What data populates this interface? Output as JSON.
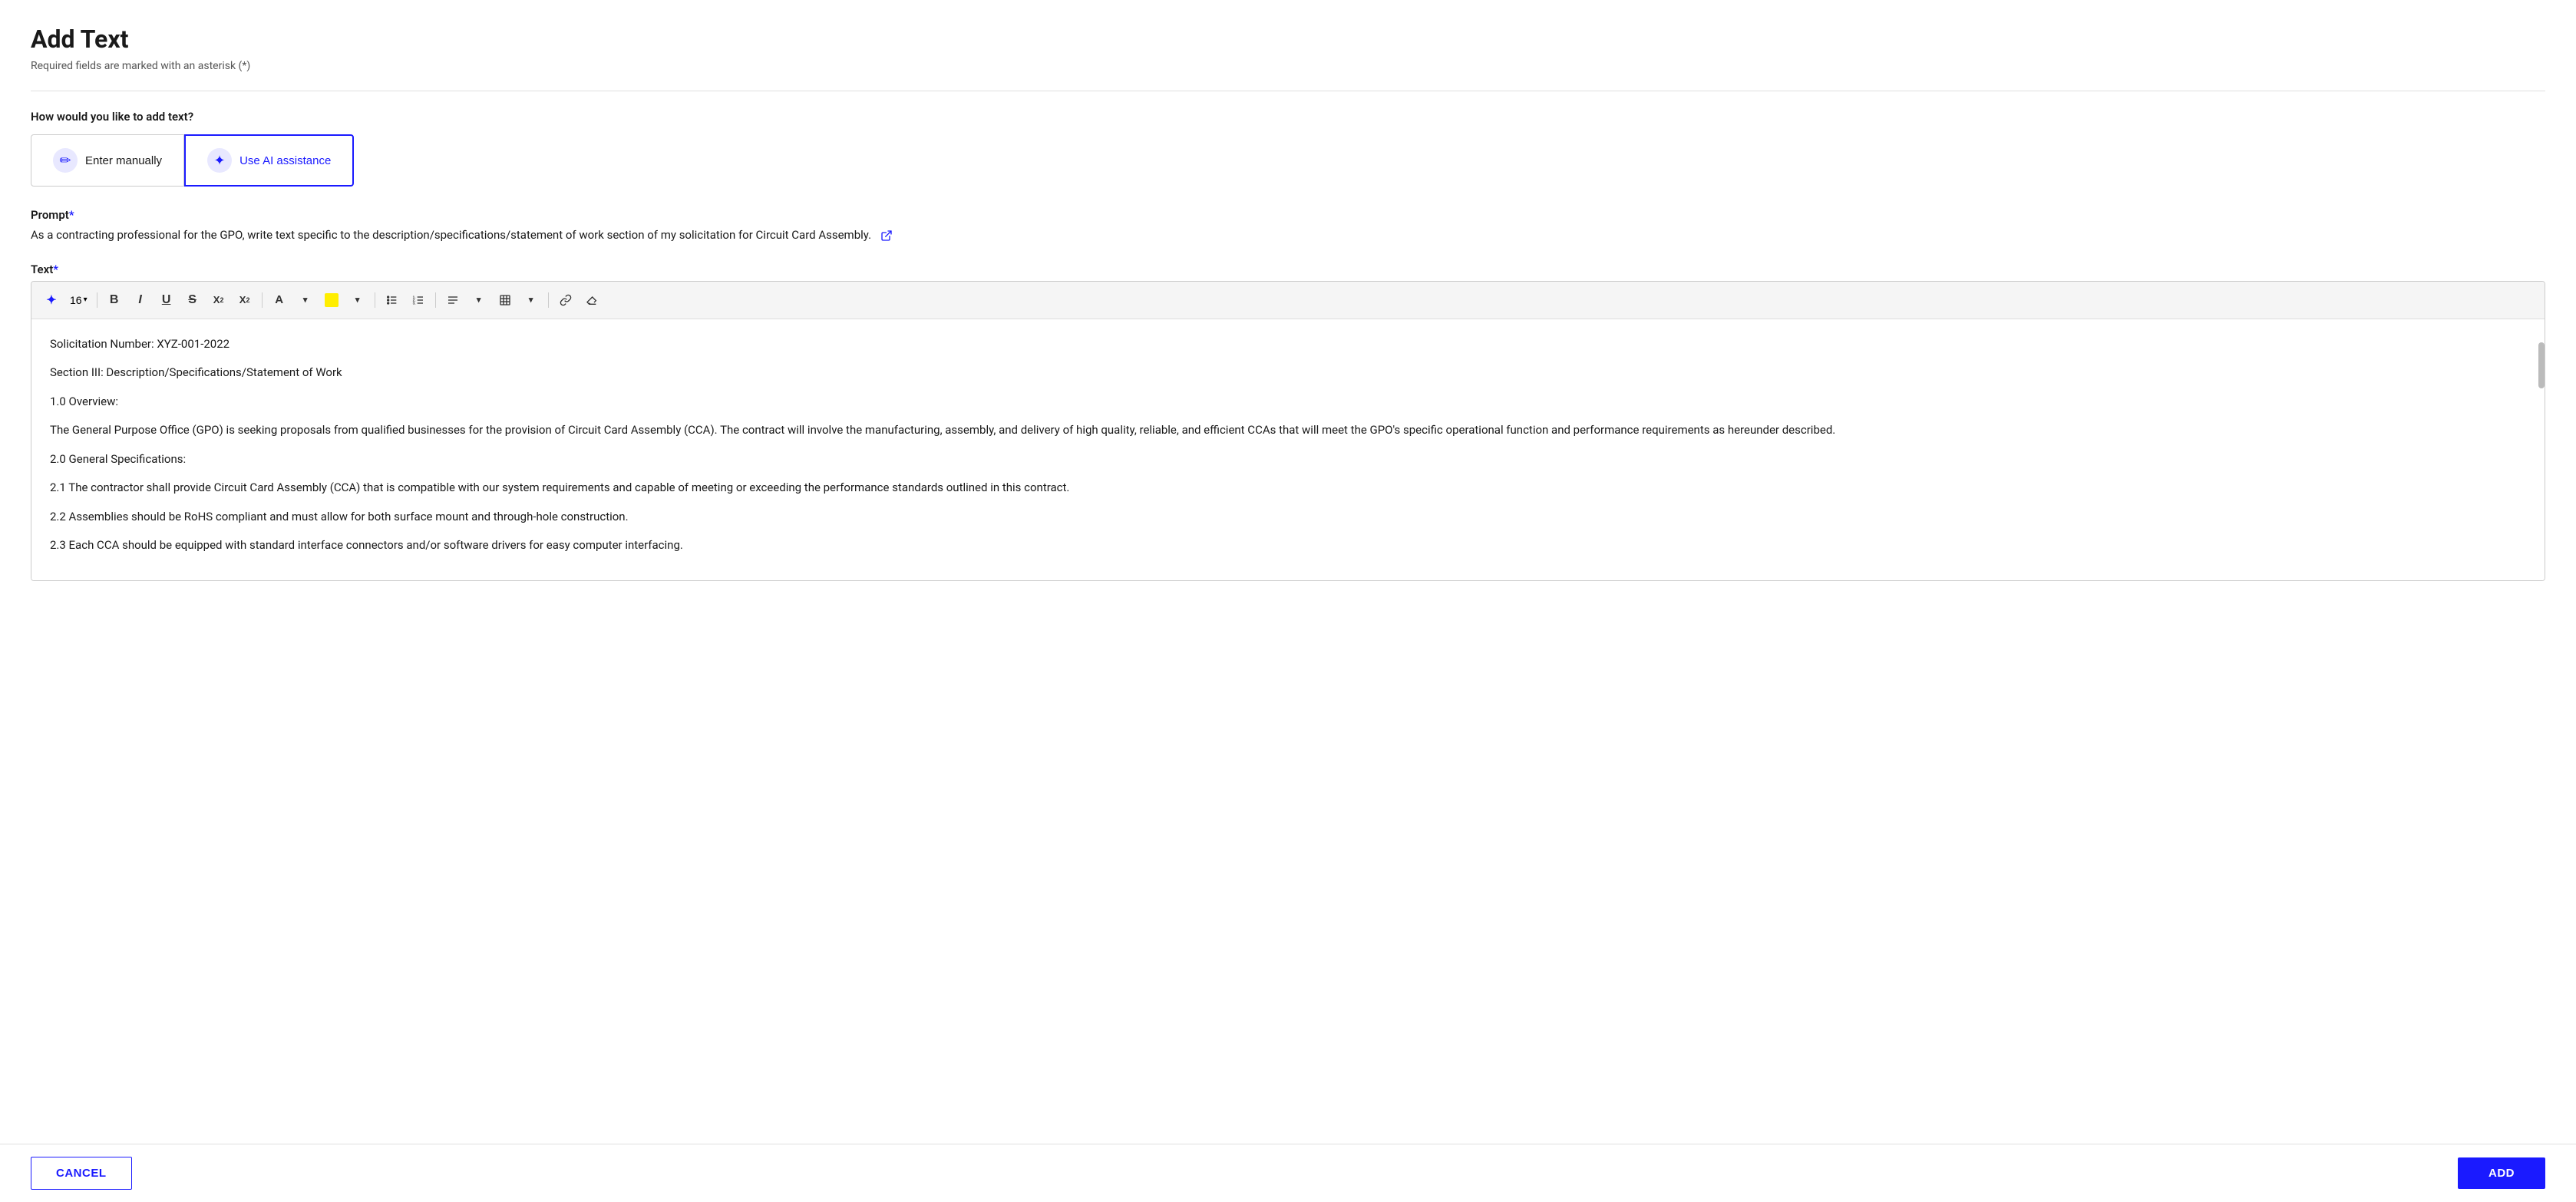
{
  "page": {
    "title": "Add Text",
    "required_note": "Required fields are marked with an asterisk (*)"
  },
  "input_method": {
    "question": "How would you like to add text?",
    "options": [
      {
        "id": "manual",
        "label": "Enter manually",
        "icon": "pencil-icon",
        "active": false
      },
      {
        "id": "ai",
        "label": "Use AI assistance",
        "icon": "ai-sparkle-icon",
        "active": true
      }
    ]
  },
  "prompt_field": {
    "label": "Prompt",
    "required": true,
    "value": "As a contracting professional for the GPO, write text specific to the description/specifications/statement of work section of my solicitation for Circuit Card Assembly.",
    "link_icon": "external-link-icon"
  },
  "text_field": {
    "label": "Text",
    "required": true,
    "toolbar": {
      "ai_btn": "✦",
      "font_size": "16",
      "bold": "B",
      "italic": "I",
      "underline": "U",
      "strikethrough": "S",
      "superscript": "X²",
      "subscript": "X₂",
      "font_color": "A",
      "highlight_color": "highlight",
      "unordered_list": "ul",
      "ordered_list": "ol",
      "align": "align",
      "table": "table",
      "link": "link",
      "eraser": "eraser"
    },
    "content": [
      "Solicitation Number: XYZ-001-2022",
      "Section III: Description/Specifications/Statement of Work",
      "1.0 Overview:",
      "The General Purpose Office (GPO) is seeking proposals from qualified businesses for the provision of Circuit Card Assembly (CCA). The contract will involve the manufacturing, assembly, and delivery of high quality, reliable, and efficient CCAs that will meet the GPO's specific operational function and performance requirements as hereunder described.",
      "2.0 General Specifications:",
      "2.1 The contractor shall provide Circuit Card Assembly (CCA) that is compatible with our system requirements and capable of meeting or exceeding the performance standards outlined in this contract.",
      "2.2 Assemblies should be RoHS compliant and must allow for both surface mount and through-hole construction.",
      "2.3 Each CCA should be equipped with standard interface connectors and/or software drivers for easy computer interfacing."
    ]
  },
  "footer": {
    "cancel_label": "CANCEL",
    "add_label": "ADD"
  }
}
